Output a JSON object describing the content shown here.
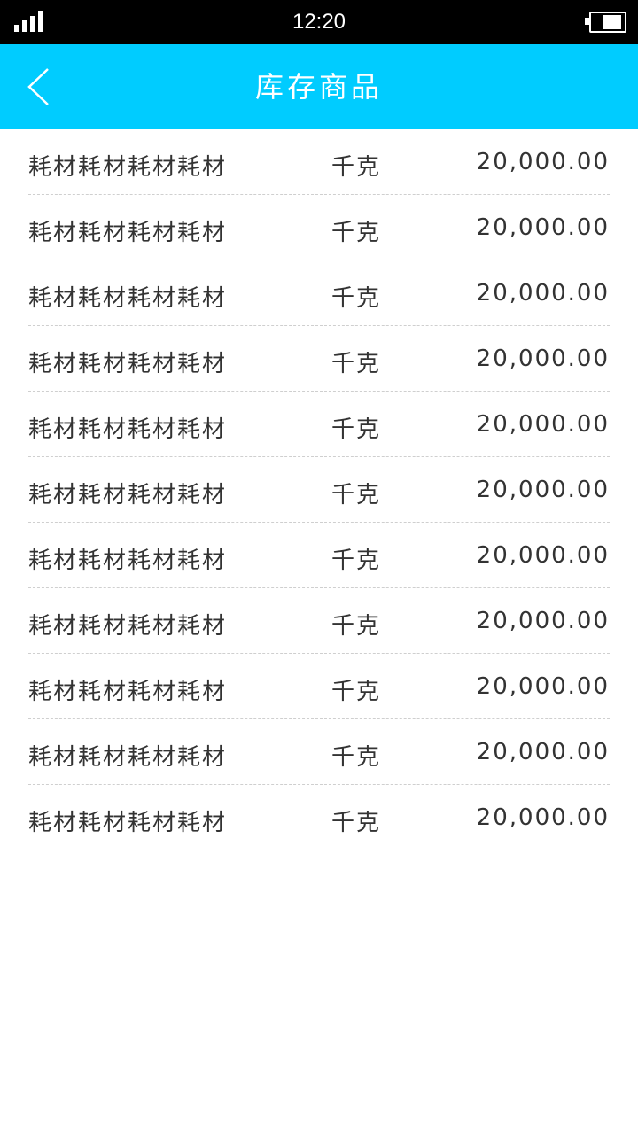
{
  "status_bar": {
    "time": "12:20",
    "signal_icon": "signal-icon",
    "battery_icon": "battery-icon"
  },
  "header": {
    "title": "库存商品",
    "back_icon": "chevron-left-icon",
    "background_color": "#00ccff"
  },
  "inventory": {
    "items": [
      {
        "name": "耗材耗材耗材耗材",
        "unit": "千克",
        "amount": "20,000.00"
      },
      {
        "name": "耗材耗材耗材耗材",
        "unit": "千克",
        "amount": "20,000.00"
      },
      {
        "name": "耗材耗材耗材耗材",
        "unit": "千克",
        "amount": "20,000.00"
      },
      {
        "name": "耗材耗材耗材耗材",
        "unit": "千克",
        "amount": "20,000.00"
      },
      {
        "name": "耗材耗材耗材耗材",
        "unit": "千克",
        "amount": "20,000.00"
      },
      {
        "name": "耗材耗材耗材耗材",
        "unit": "千克",
        "amount": "20,000.00"
      },
      {
        "name": "耗材耗材耗材耗材",
        "unit": "千克",
        "amount": "20,000.00"
      },
      {
        "name": "耗材耗材耗材耗材",
        "unit": "千克",
        "amount": "20,000.00"
      },
      {
        "name": "耗材耗材耗材耗材",
        "unit": "千克",
        "amount": "20,000.00"
      },
      {
        "name": "耗材耗材耗材耗材",
        "unit": "千克",
        "amount": "20,000.00"
      },
      {
        "name": "耗材耗材耗材耗材",
        "unit": "千克",
        "amount": "20,000.00"
      }
    ]
  }
}
